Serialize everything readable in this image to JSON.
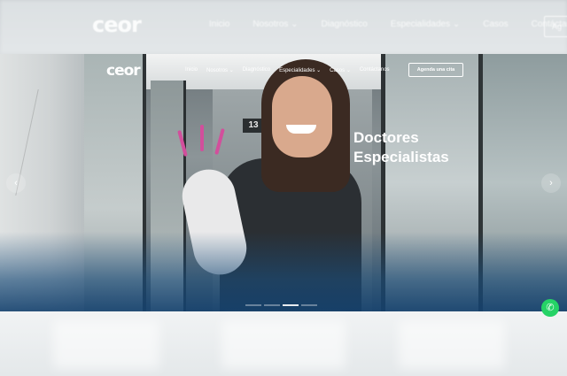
{
  "header": {
    "logo": "ceor",
    "nav": [
      "Inicio",
      "Nosotros ⌄",
      "Diagnóstico",
      "Especialidades ⌄",
      "Casos",
      "Contáctanos"
    ],
    "cta": "Ag"
  },
  "hero": {
    "logo": "ceor",
    "nav": [
      "Inicio",
      "Nosotros ⌄",
      "Diagnóstico",
      "Especialidades ⌄",
      "Casos ⌄",
      "Contáctanos"
    ],
    "cta": "Agenda una cita",
    "title_line1": "Doctores",
    "title_line2": "Especialistas",
    "door_sign": "13",
    "slides_total": 4,
    "active_slide": 3,
    "arrow_prev": "‹",
    "arrow_next": "›"
  },
  "whatsapp": {
    "icon": "whatsapp-icon"
  },
  "colors": {
    "accent": "#25d366",
    "hero_overlay": "#1b4a78",
    "cta_border": "#ffffff"
  }
}
